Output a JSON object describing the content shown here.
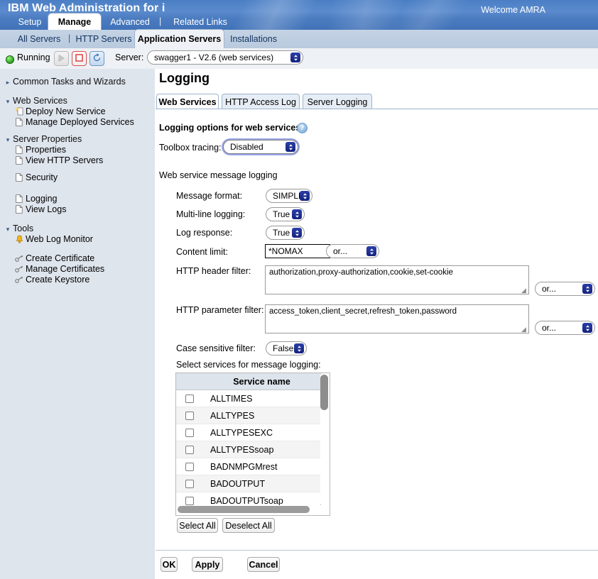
{
  "header": {
    "product_title": "IBM Web Administration for i",
    "welcome": "Welcome  AMRA",
    "primary_tabs": [
      {
        "label": "Setup",
        "active": false
      },
      {
        "label": "Manage",
        "active": true
      },
      {
        "label": "Advanced",
        "active": false
      },
      {
        "label": "Related Links",
        "active": false
      }
    ],
    "primary_separator": "|",
    "secondary_tabs": [
      {
        "label": "All Servers",
        "active": false
      },
      {
        "label": "HTTP Servers",
        "active": false
      },
      {
        "label": "Application Servers",
        "active": true
      },
      {
        "label": "Installations",
        "active": false
      }
    ],
    "secondary_separator": "|"
  },
  "server_toolbar": {
    "status": "Running",
    "status_color": "#3cb52b",
    "start_icon": "play-icon",
    "stop_icon": "stop-icon",
    "restart_icon": "restart-icon",
    "server_label": "Server:",
    "server_value": "swagger1 - V2.6 (web services)"
  },
  "sidebar": {
    "groups": [
      {
        "label": "Common Tasks and Wizards",
        "icon": "triangle-right-icon",
        "expanded": false,
        "items": []
      },
      {
        "label": "Web Services",
        "icon": "triangle-down-icon",
        "expanded": true,
        "items": [
          {
            "label": "Deploy New Service",
            "icon": "wizard-icon"
          },
          {
            "label": "Manage Deployed Services",
            "icon": "page-icon"
          }
        ]
      },
      {
        "label": "Server Properties",
        "icon": "triangle-down-icon",
        "expanded": true,
        "items": [
          {
            "label": "Properties",
            "icon": "page-icon"
          },
          {
            "label": "View HTTP Servers",
            "icon": "page-icon"
          }
        ]
      },
      {
        "label": "",
        "icon": "",
        "expanded": true,
        "items": [
          {
            "label": "Security",
            "icon": "page-icon"
          }
        ]
      },
      {
        "label": "",
        "icon": "",
        "expanded": true,
        "items": [
          {
            "label": "Logging",
            "icon": "page-icon"
          },
          {
            "label": "View Logs",
            "icon": "page-icon"
          }
        ]
      },
      {
        "label": "Tools",
        "icon": "triangle-down-icon",
        "expanded": true,
        "items": [
          {
            "label": "Web Log Monitor",
            "icon": "bell-icon"
          }
        ]
      },
      {
        "label": "",
        "icon": "",
        "expanded": true,
        "items": [
          {
            "label": "Create Certificate",
            "icon": "key-icon"
          },
          {
            "label": "Manage Certificates",
            "icon": "key-icon"
          },
          {
            "label": "Create Keystore",
            "icon": "key-icon"
          }
        ]
      }
    ]
  },
  "main": {
    "page_title": "Logging",
    "tabs": [
      {
        "label": "Web Services",
        "active": true
      },
      {
        "label": "HTTP Access Log",
        "active": false
      },
      {
        "label": "Server Logging",
        "active": false
      }
    ],
    "options_heading": "Logging options for web services",
    "help_icon": "help-icon",
    "toolbox_tracing": {
      "label": "Toolbox tracing:",
      "value": "Disabled"
    },
    "message_logging_heading": "Web service message logging",
    "fields": {
      "message_format": {
        "label": "Message format:",
        "value": "SIMPLE"
      },
      "multiline_logging": {
        "label": "Multi-line logging:",
        "value": "True"
      },
      "log_response": {
        "label": "Log response:",
        "value": "True"
      },
      "content_limit": {
        "label": "Content limit:",
        "value": "*NOMAX",
        "alt_select": "or..."
      },
      "http_header_filter": {
        "label": "HTTP header filter:",
        "value": "authorization,proxy-authorization,cookie,set-cookie",
        "alt_select": "or..."
      },
      "http_parameter_filter": {
        "label": "HTTP parameter filter:",
        "value": "access_token,client_secret,refresh_token,password",
        "alt_select": "or..."
      },
      "case_sensitive_filter": {
        "label": "Case sensitive filter:",
        "value": "False"
      }
    },
    "service_list": {
      "caption": "Select services for message logging:",
      "column_header": "Service name",
      "rows": [
        {
          "name": "ALLTIMES",
          "checked": false
        },
        {
          "name": "ALLTYPES",
          "checked": false
        },
        {
          "name": "ALLTYPESEXC",
          "checked": false
        },
        {
          "name": "ALLTYPESsoap",
          "checked": false
        },
        {
          "name": "BADNMPGMrest",
          "checked": false
        },
        {
          "name": "BADOUTPUT",
          "checked": false
        },
        {
          "name": "BADOUTPUTsoap",
          "checked": false
        }
      ],
      "select_all_label": "Select All",
      "deselect_all_label": "Deselect All"
    },
    "actions": {
      "ok_label": "OK",
      "apply_label": "Apply",
      "cancel_label": "Cancel"
    }
  }
}
